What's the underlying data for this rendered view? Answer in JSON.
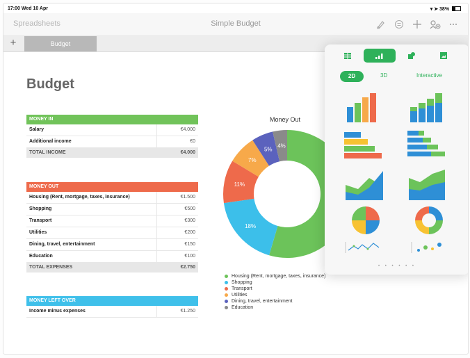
{
  "status_bar": {
    "time_date": "17:00 Wed 10 Apr",
    "right": "38%"
  },
  "toolbar": {
    "back_label": "Spreadsheets",
    "title": "Simple Budget",
    "icons": [
      "brush-icon",
      "format-icon",
      "plus-icon",
      "collaborate-icon",
      "more-icon"
    ]
  },
  "tabs": {
    "add_label": "+",
    "active_tab": "Budget"
  },
  "sheet": {
    "title": "Budget",
    "money_in": {
      "header": "MONEY IN",
      "header_color": "#71c35a",
      "rows": [
        {
          "label": "Salary",
          "value": "€4.000"
        },
        {
          "label": "Additional income",
          "value": "€0"
        }
      ],
      "total": {
        "label": "TOTAL INCOME",
        "value": "€4.000"
      }
    },
    "money_out": {
      "header": "MONEY OUT",
      "header_color": "#ee6a4b",
      "rows": [
        {
          "label": "Housing (Rent, mortgage, taxes, insurance)",
          "value": "€1.500"
        },
        {
          "label": "Shopping",
          "value": "€500"
        },
        {
          "label": "Transport",
          "value": "€300"
        },
        {
          "label": "Utilities",
          "value": "€200"
        },
        {
          "label": "Dining, travel, entertainment",
          "value": "€150"
        },
        {
          "label": "Education",
          "value": "€100"
        }
      ],
      "total": {
        "label": "TOTAL EXPENSES",
        "value": "€2.750"
      }
    },
    "money_left": {
      "header": "MONEY LEFT OVER",
      "header_color": "#3fc0ea",
      "rows": [
        {
          "label": "Income minus expenses",
          "value": "€1.250"
        }
      ]
    }
  },
  "chart_data": {
    "type": "pie",
    "title": "Money Out",
    "categories": [
      "Housing (Rent, mortgage, taxes, insurance)",
      "Shopping",
      "Transport",
      "Utilities",
      "Dining, travel, entertainment",
      "Education"
    ],
    "values": [
      1500,
      500,
      300,
      200,
      150,
      100
    ],
    "slice_labels": [
      "",
      "18%",
      "11%",
      "7%",
      "5%",
      "4%"
    ],
    "colors": [
      "#6cc35a",
      "#3cbfea",
      "#ee6a4b",
      "#f7a94a",
      "#5b62bd",
      "#8a8a8a"
    ],
    "donut": true,
    "legend_position": "bottom"
  },
  "chart_popover": {
    "tabs": [
      "table-icon",
      "chart-icon",
      "shape-icon",
      "media-icon"
    ],
    "active_tab": 1,
    "segments": [
      "2D",
      "3D",
      "Interactive"
    ],
    "active_segment": "2D",
    "thumbnails": [
      "column-chart",
      "stacked-column-chart",
      "bar-chart",
      "stacked-bar-chart",
      "area-chart",
      "stacked-area-chart",
      "pie-chart",
      "donut-chart",
      "scatter-chart",
      "bubble-chart"
    ],
    "page_dots": "• • • • • •",
    "accent": "#2eb15a"
  }
}
